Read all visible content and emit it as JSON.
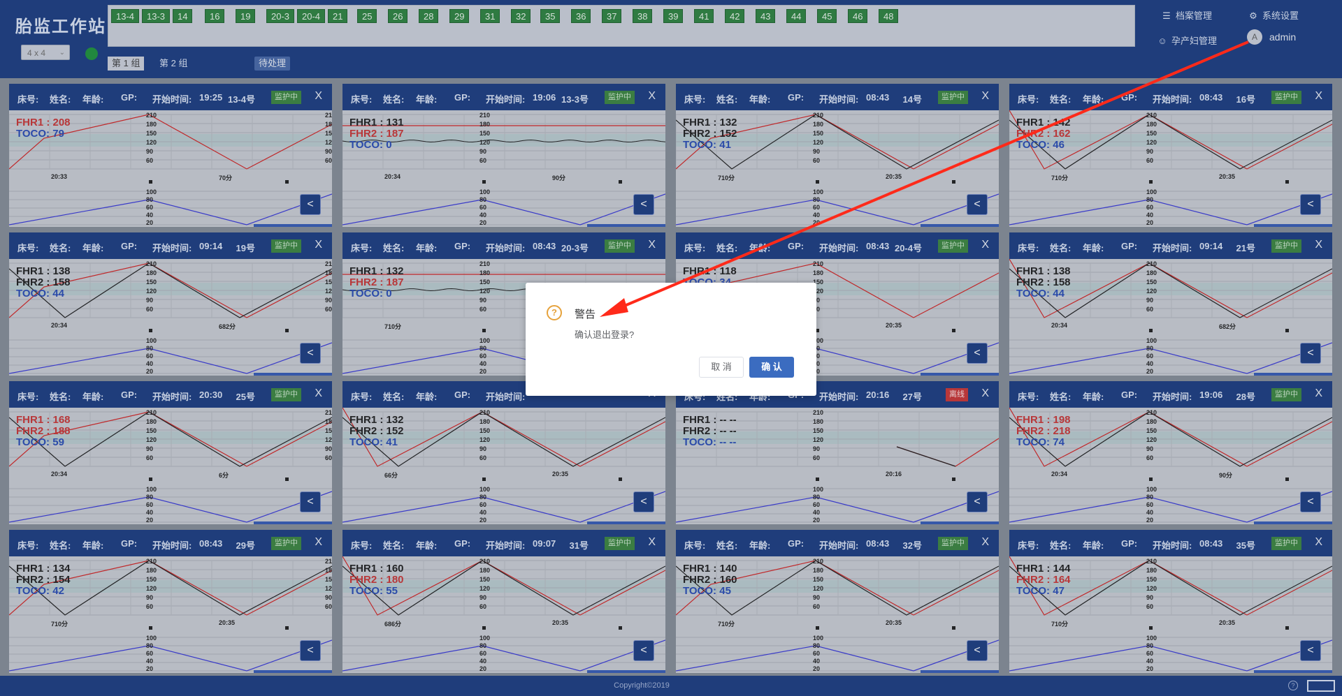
{
  "app": {
    "title": "胎监工作站",
    "layout_value": "4 x 4",
    "status_dot_color": "#0e8a2e"
  },
  "bed_chips": [
    "13-4",
    "13-3",
    "14",
    "16",
    "19",
    "20-3",
    "20-4",
    "21",
    "25",
    "26",
    "28",
    "29",
    "31",
    "32",
    "35",
    "36",
    "37",
    "38",
    "39",
    "41",
    "42",
    "43",
    "44",
    "45",
    "46",
    "48"
  ],
  "group_tabs": [
    "第 1 组",
    "第 2 组"
  ],
  "pending_label": "待处理",
  "top_menu": {
    "records": "档案管理",
    "settings": "系统设置",
    "patients": "孕产妇管理",
    "avatar_letter": "A",
    "user": "admin"
  },
  "card_labels": {
    "bed": "床号:",
    "name": "姓名:",
    "age": "年龄:",
    "gp": "GP:",
    "start": "开始时间:",
    "close": "X",
    "toggle": "<"
  },
  "cards": [
    {
      "start": "19:25",
      "bed": "13-4号",
      "status": "监护中",
      "fhr1": "FHR1 : 208",
      "fhr2": "",
      "toco": "TOCO: 79",
      "t1": "20:33",
      "t2": "70分",
      "fhr1_red": true,
      "fhr2_red": false,
      "offline": false
    },
    {
      "start": "19:06",
      "bed": "13-3号",
      "status": "监护中",
      "fhr1": "FHR1 : 131",
      "fhr2": "FHR2 : 187",
      "toco": "TOCO: 0",
      "t1": "20:34",
      "t2": "90分",
      "fhr1_red": false,
      "fhr2_red": true,
      "offline": false
    },
    {
      "start": "08:43",
      "bed": "14号",
      "status": "监护中",
      "fhr1": "FHR1 : 132",
      "fhr2": "FHR2 : 152",
      "toco": "TOCO: 41",
      "t1": "710分",
      "t2": "20:35",
      "fhr1_red": false,
      "fhr2_red": false,
      "offline": false
    },
    {
      "start": "08:43",
      "bed": "16号",
      "status": "监护中",
      "fhr1": "FHR1 : 142",
      "fhr2": "FHR2 : 162",
      "toco": "TOCO: 46",
      "t1": "710分",
      "t2": "20:35",
      "fhr1_red": false,
      "fhr2_red": true,
      "offline": false
    },
    {
      "start": "09:14",
      "bed": "19号",
      "status": "监护中",
      "fhr1": "FHR1 : 138",
      "fhr2": "FHR2 : 158",
      "toco": "TOCO: 44",
      "t1": "20:34",
      "t2": "682分",
      "fhr1_red": false,
      "fhr2_red": false,
      "offline": false
    },
    {
      "start": "08:43",
      "bed": "20-3号",
      "status": "监护中",
      "fhr1": "FHR1 : 132",
      "fhr2": "FHR2 : 187",
      "toco": "TOCO: 0",
      "t1": "710分",
      "t2": "",
      "fhr1_red": false,
      "fhr2_red": true,
      "offline": false
    },
    {
      "start": "08:43",
      "bed": "20-4号",
      "status": "监护中",
      "fhr1": "FHR1 : 118",
      "fhr2": "",
      "toco": "TOCO: 34",
      "t1": "",
      "t2": "20:35",
      "fhr1_red": false,
      "fhr2_red": false,
      "offline": false
    },
    {
      "start": "09:14",
      "bed": "21号",
      "status": "监护中",
      "fhr1": "FHR1 : 138",
      "fhr2": "FHR2 : 158",
      "toco": "TOCO: 44",
      "t1": "20:34",
      "t2": "682分",
      "fhr1_red": false,
      "fhr2_red": false,
      "offline": false
    },
    {
      "start": "20:30",
      "bed": "25号",
      "status": "监护中",
      "fhr1": "FHR1 : 168",
      "fhr2": "FHR2 : 188",
      "toco": "TOCO: 59",
      "t1": "20:34",
      "t2": "6分",
      "fhr1_red": true,
      "fhr2_red": true,
      "offline": false
    },
    {
      "start": "",
      "bed": "",
      "status": "",
      "fhr1": "FHR1 : 132",
      "fhr2": "FHR2 : 152",
      "toco": "TOCO: 41",
      "t1": "66分",
      "t2": "20:35",
      "fhr1_red": false,
      "fhr2_red": false,
      "offline": false
    },
    {
      "start": "20:16",
      "bed": "27号",
      "status": "离线",
      "fhr1": "FHR1 : -- --",
      "fhr2": "FHR2 : -- --",
      "toco": "TOCO: -- --",
      "t1": "",
      "t2": "20:16",
      "fhr1_red": false,
      "fhr2_red": false,
      "offline": true
    },
    {
      "start": "19:06",
      "bed": "28号",
      "status": "监护中",
      "fhr1": "FHR1 : 198",
      "fhr2": "FHR2 : 218",
      "toco": "TOCO: 74",
      "t1": "20:34",
      "t2": "90分",
      "fhr1_red": true,
      "fhr2_red": true,
      "offline": false
    },
    {
      "start": "08:43",
      "bed": "29号",
      "status": "监护中",
      "fhr1": "FHR1 : 134",
      "fhr2": "FHR2 : 154",
      "toco": "TOCO: 42",
      "t1": "710分",
      "t2": "20:35",
      "fhr1_red": false,
      "fhr2_red": false,
      "offline": false
    },
    {
      "start": "09:07",
      "bed": "31号",
      "status": "监护中",
      "fhr1": "FHR1 : 160",
      "fhr2": "FHR2 : 180",
      "toco": "TOCO: 55",
      "t1": "686分",
      "t2": "20:35",
      "fhr1_red": false,
      "fhr2_red": true,
      "offline": false
    },
    {
      "start": "08:43",
      "bed": "32号",
      "status": "监护中",
      "fhr1": "FHR1 : 140",
      "fhr2": "FHR2 : 160",
      "toco": "TOCO: 45",
      "t1": "710分",
      "t2": "20:35",
      "fhr1_red": false,
      "fhr2_red": false,
      "offline": false
    },
    {
      "start": "08:43",
      "bed": "35号",
      "status": "监护中",
      "fhr1": "FHR1 : 144",
      "fhr2": "FHR2 : 164",
      "toco": "TOCO: 47",
      "t1": "710分",
      "t2": "20:35",
      "fhr1_red": false,
      "fhr2_red": true,
      "offline": false
    }
  ],
  "fhr_ticks": [
    "210",
    "180",
    "150",
    "120",
    "90",
    "60"
  ],
  "toco_ticks": [
    "100",
    "80",
    "60",
    "40",
    "20"
  ],
  "footer": {
    "copyright": "Copyright©2019",
    "help": "?"
  },
  "dialog": {
    "icon": "?",
    "title": "警告",
    "message": "确认退出登录?",
    "cancel": "取 消",
    "ok": "确 认"
  }
}
